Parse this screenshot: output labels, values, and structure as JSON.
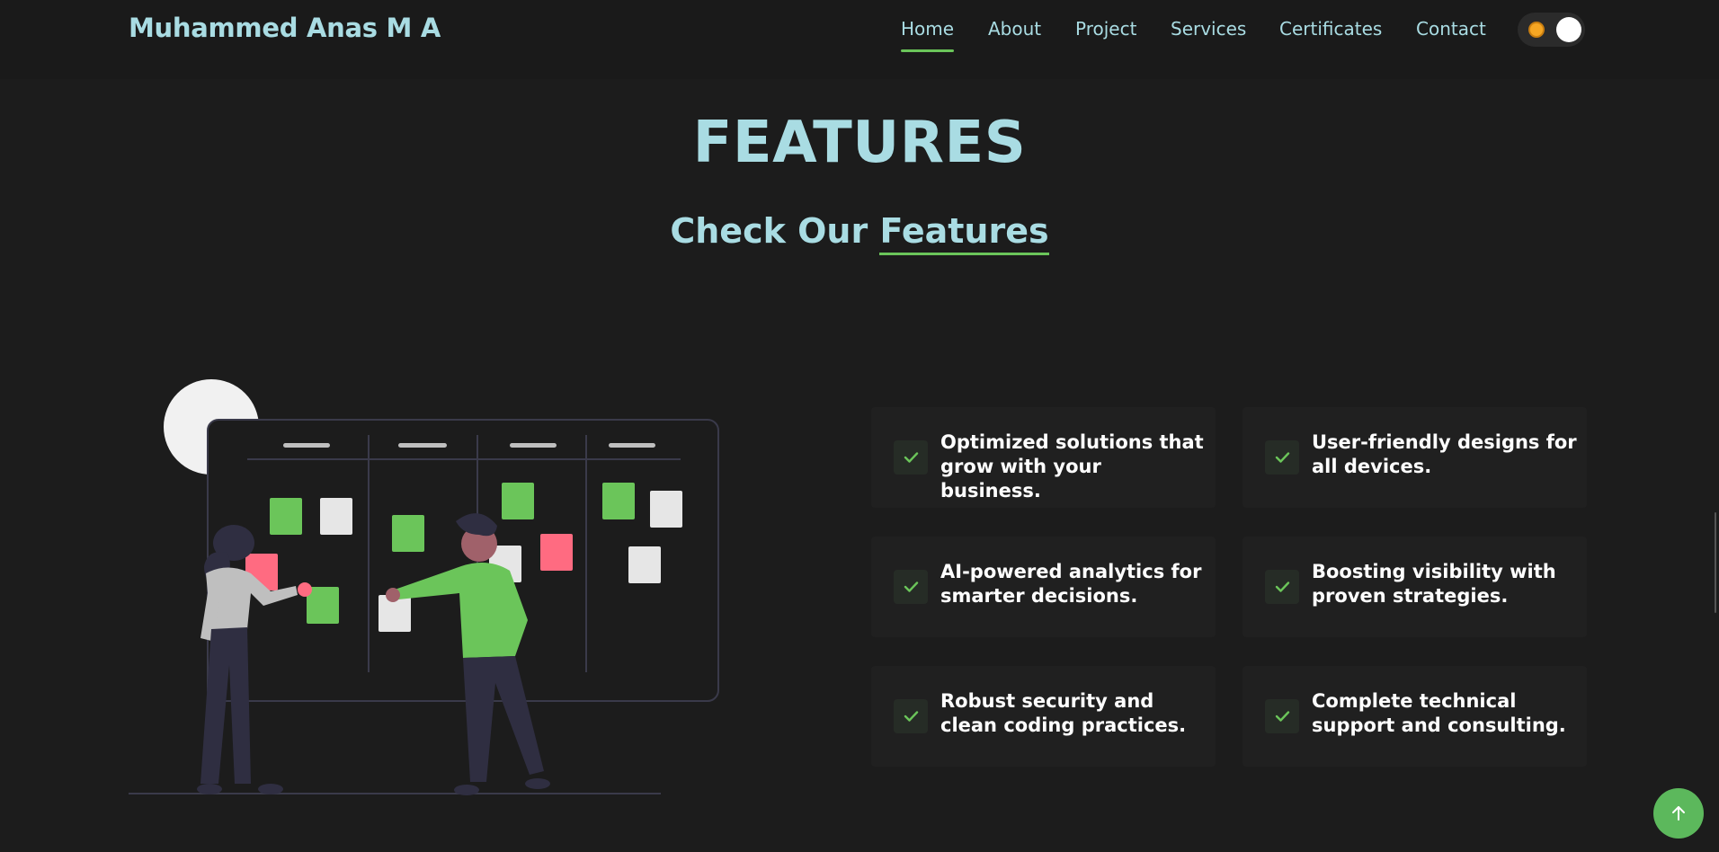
{
  "brand": "Muhammed Anas M A",
  "nav": {
    "home": "Home",
    "about": "About",
    "project": "Project",
    "services": "Services",
    "certificates": "Certificates",
    "contact": "Contact"
  },
  "section": {
    "title": "FEATURES",
    "subtitle_prefix": "Check Our ",
    "subtitle_highlight": "Features"
  },
  "features": [
    {
      "text": "Optimized solutions that grow with your business."
    },
    {
      "text": "User-friendly designs for all devices."
    },
    {
      "text": "AI-powered analytics for smarter decisions."
    },
    {
      "text": "Boosting visibility with proven strategies."
    },
    {
      "text": "Robust security and clean coding practices."
    },
    {
      "text": "Complete technical support and consulting."
    }
  ],
  "icons": {
    "check": "check-icon",
    "theme": "sun-icon",
    "scroll_top": "arrow-up-icon"
  },
  "colors": {
    "background": "#1c1c1c",
    "accent": "#6bc55a",
    "heading": "#a9dce3",
    "card": "#202020"
  }
}
